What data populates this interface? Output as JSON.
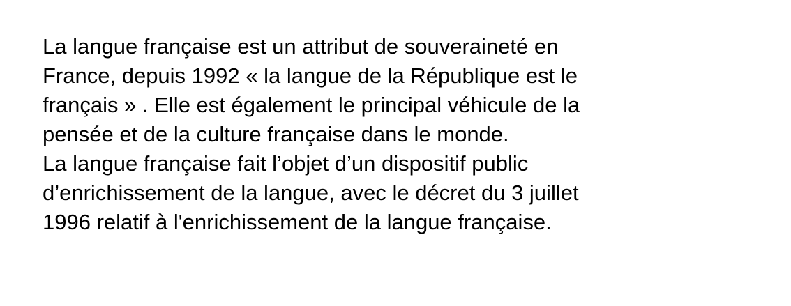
{
  "document": {
    "lines": [
      "La langue française est un attribut de souveraineté en",
      "France, depuis 1992 « la langue de la République est le",
      "français » . Elle est également le principal véhicule de la",
      "pensée et de la culture française dans le monde.",
      "La langue française fait l’objet d’un dispositif public",
      "d’enrichissement de la langue, avec le décret du 3 juillet",
      "1996 relatif à l'enrichissement de la langue française."
    ]
  },
  "colors": {
    "background": "#ffffff",
    "text": "#000000"
  }
}
